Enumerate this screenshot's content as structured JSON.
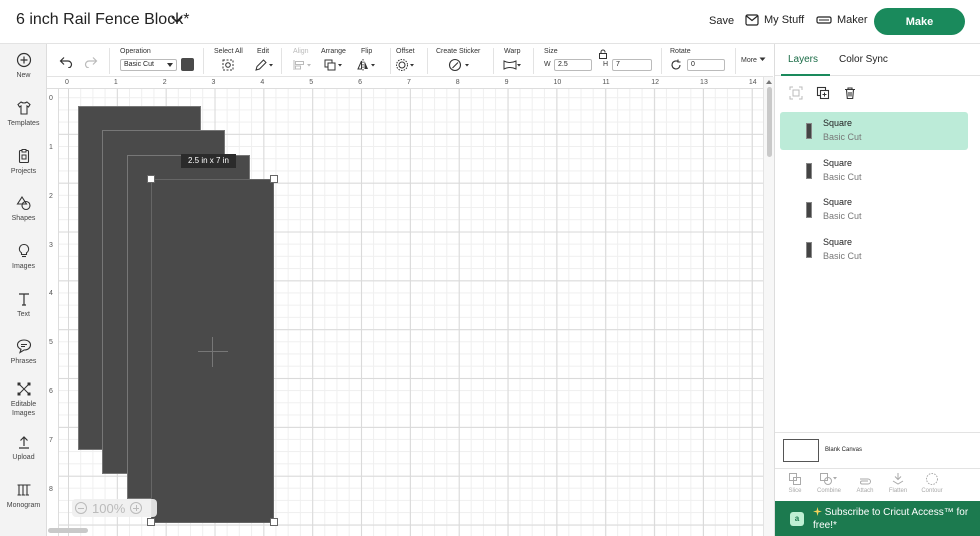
{
  "header": {
    "project_title": "6 inch Rail Fence Block*",
    "save_label": "Save",
    "my_stuff_label": "My Stuff",
    "maker_label": "Maker",
    "make_label": "Make"
  },
  "sidebar": {
    "items": [
      {
        "label": "New",
        "icon": "plus-circle-icon"
      },
      {
        "label": "Templates",
        "icon": "tshirt-icon"
      },
      {
        "label": "Projects",
        "icon": "clipboard-icon"
      },
      {
        "label": "Shapes",
        "icon": "shapes-icon"
      },
      {
        "label": "Images",
        "icon": "lightbulb-icon"
      },
      {
        "label": "Text",
        "icon": "text-t-icon"
      },
      {
        "label": "Phrases",
        "icon": "speech-bubble-icon"
      },
      {
        "label": "Editable",
        "label2": "Images",
        "icon": "editable-image-icon"
      },
      {
        "label": "Upload",
        "icon": "upload-arrow-icon"
      },
      {
        "label": "Monogram",
        "icon": "monogram-icon"
      }
    ]
  },
  "toolbar": {
    "operation_label": "Operation",
    "operation_value": "Basic Cut",
    "operation_color": "#4a4a4a",
    "select_all_label": "Select All",
    "edit_label": "Edit",
    "align_label": "Align",
    "arrange_label": "Arrange",
    "flip_label": "Flip",
    "offset_label": "Offset",
    "create_sticker_label": "Create Sticker",
    "warp_label": "Warp",
    "size_label": "Size",
    "width_tag": "W",
    "width_value": "2.5",
    "height_tag": "H",
    "height_value": "7",
    "rotate_label": "Rotate",
    "rotate_value": "0",
    "more_label": "More"
  },
  "rulers": {
    "top": [
      "0",
      "1",
      "2",
      "3",
      "4",
      "5",
      "6",
      "7",
      "8",
      "9",
      "10",
      "11",
      "12",
      "13",
      "14"
    ],
    "left": [
      "0",
      "1",
      "2",
      "3",
      "4",
      "5",
      "6",
      "7",
      "8"
    ]
  },
  "canvas": {
    "size_tooltip": "2.5  in x 7  in",
    "zoom_label": "100%",
    "shape_color": "#4a4a4a"
  },
  "right_panel": {
    "tab_layers": "Layers",
    "tab_color_sync": "Color Sync",
    "layers": [
      {
        "name": "Square",
        "operation": "Basic Cut",
        "selected": true
      },
      {
        "name": "Square",
        "operation": "Basic Cut",
        "selected": false
      },
      {
        "name": "Square",
        "operation": "Basic Cut",
        "selected": false
      },
      {
        "name": "Square",
        "operation": "Basic Cut",
        "selected": false
      }
    ],
    "blank_canvas_label": "Blank Canvas",
    "bottom_tools": [
      "Slice",
      "Combine",
      "Attach",
      "Flatten",
      "Contour"
    ],
    "access_banner_text": "Subscribe to Cricut Access™ for free!*",
    "access_logo_letter": "a",
    "accent_color": "#1a8a5c"
  }
}
